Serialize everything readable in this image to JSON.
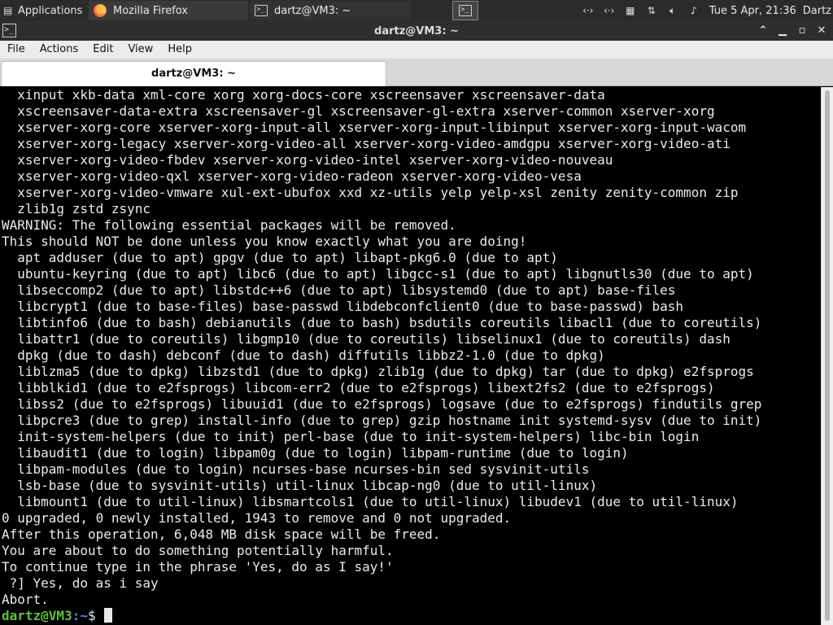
{
  "panel": {
    "apps_label": "Applications",
    "tasks": [
      {
        "label": "Mozilla Firefox",
        "icon": "firefox-icon"
      },
      {
        "label": "dartz@VM3: ~",
        "icon": "terminal-icon"
      }
    ],
    "clock": "Tue  5 Apr, 21:36",
    "user": "Dartz"
  },
  "window": {
    "title": "dartz@VM3: ~",
    "menu": [
      "File",
      "Actions",
      "Edit",
      "View",
      "Help"
    ],
    "tab_label": "dartz@VM3: ~"
  },
  "terminal": {
    "lines": [
      "  xinput xkb-data xml-core xorg xorg-docs-core xscreensaver xscreensaver-data",
      "  xscreensaver-data-extra xscreensaver-gl xscreensaver-gl-extra xserver-common xserver-xorg",
      "  xserver-xorg-core xserver-xorg-input-all xserver-xorg-input-libinput xserver-xorg-input-wacom",
      "  xserver-xorg-legacy xserver-xorg-video-all xserver-xorg-video-amdgpu xserver-xorg-video-ati",
      "  xserver-xorg-video-fbdev xserver-xorg-video-intel xserver-xorg-video-nouveau",
      "  xserver-xorg-video-qxl xserver-xorg-video-radeon xserver-xorg-video-vesa",
      "  xserver-xorg-video-vmware xul-ext-ubufox xxd xz-utils yelp yelp-xsl zenity zenity-common zip",
      "  zlib1g zstd zsync",
      "WARNING: The following essential packages will be removed.",
      "This should NOT be done unless you know exactly what you are doing!",
      "  apt adduser (due to apt) gpgv (due to apt) libapt-pkg6.0 (due to apt)",
      "  ubuntu-keyring (due to apt) libc6 (due to apt) libgcc-s1 (due to apt) libgnutls30 (due to apt)",
      "  libseccomp2 (due to apt) libstdc++6 (due to apt) libsystemd0 (due to apt) base-files",
      "  libcrypt1 (due to base-files) base-passwd libdebconfclient0 (due to base-passwd) bash",
      "  libtinfo6 (due to bash) debianutils (due to bash) bsdutils coreutils libacl1 (due to coreutils)",
      "  libattr1 (due to coreutils) libgmp10 (due to coreutils) libselinux1 (due to coreutils) dash",
      "  dpkg (due to dash) debconf (due to dash) diffutils libbz2-1.0 (due to dpkg)",
      "  liblzma5 (due to dpkg) libzstd1 (due to dpkg) zlib1g (due to dpkg) tar (due to dpkg) e2fsprogs",
      "  libblkid1 (due to e2fsprogs) libcom-err2 (due to e2fsprogs) libext2fs2 (due to e2fsprogs)",
      "  libss2 (due to e2fsprogs) libuuid1 (due to e2fsprogs) logsave (due to e2fsprogs) findutils grep",
      "  libpcre3 (due to grep) install-info (due to grep) gzip hostname init systemd-sysv (due to init)",
      "  init-system-helpers (due to init) perl-base (due to init-system-helpers) libc-bin login",
      "  libaudit1 (due to login) libpam0g (due to login) libpam-runtime (due to login)",
      "  libpam-modules (due to login) ncurses-base ncurses-bin sed sysvinit-utils",
      "  lsb-base (due to sysvinit-utils) util-linux libcap-ng0 (due to util-linux)",
      "  libmount1 (due to util-linux) libsmartcols1 (due to util-linux) libudev1 (due to util-linux)",
      "0 upgraded, 0 newly installed, 1943 to remove and 0 not upgraded.",
      "After this operation, 6,048 MB disk space will be freed.",
      "You are about to do something potentially harmful.",
      "To continue type in the phrase 'Yes, do as I say!'",
      " ?] Yes, do as i say",
      "Abort."
    ],
    "prompt_user": "dartz@VM3",
    "prompt_path": ":~",
    "prompt_symbol": "$"
  }
}
